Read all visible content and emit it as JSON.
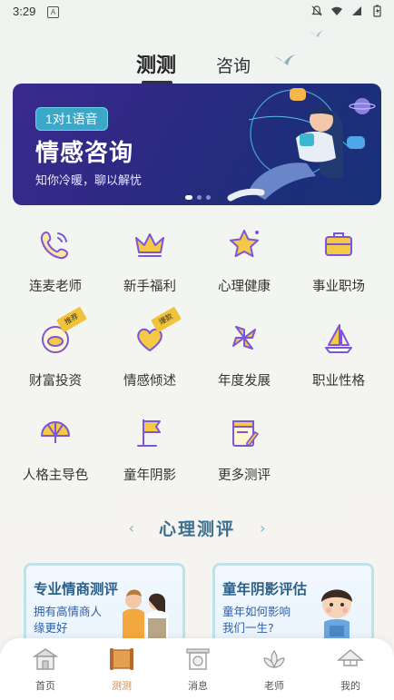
{
  "status_bar": {
    "time": "3:29",
    "app_icon": "A"
  },
  "top_tabs": [
    {
      "label": "测测",
      "active": true
    },
    {
      "label": "咨询",
      "active": false
    }
  ],
  "banner": {
    "tag": "1对1语音",
    "title": "情感咨询",
    "subtitle": "知你冷暖，聊以解忧",
    "slide_count": 3,
    "active_slide": 0
  },
  "grid": [
    {
      "label": "连麦老师",
      "icon": "phone-icon"
    },
    {
      "label": "新手福利",
      "icon": "crown-icon"
    },
    {
      "label": "心理健康",
      "icon": "star-icon"
    },
    {
      "label": "事业职场",
      "icon": "briefcase-icon"
    },
    {
      "label": "财富投资",
      "icon": "money-pot-icon",
      "badge": "推荐"
    },
    {
      "label": "情感倾述",
      "icon": "heart-icon",
      "badge": "爆款"
    },
    {
      "label": "年度发展",
      "icon": "pinwheel-icon"
    },
    {
      "label": "职业性格",
      "icon": "sailboat-icon"
    },
    {
      "label": "人格主导色",
      "icon": "fan-icon"
    },
    {
      "label": "童年阴影",
      "icon": "flag-icon"
    },
    {
      "label": "更多测评",
      "icon": "clipboard-icon"
    }
  ],
  "section": {
    "title": "心理测评"
  },
  "cards": [
    {
      "title": "专业情商测评",
      "subtitle": "拥有高情商人缘更好"
    },
    {
      "title": "童年阴影评估",
      "subtitle": "童年如何影响我们一生?"
    }
  ],
  "tabbar": [
    {
      "label": "首页",
      "icon": "home-icon",
      "active": false
    },
    {
      "label": "测测",
      "icon": "scroll-icon",
      "active": true
    },
    {
      "label": "消息",
      "icon": "gate-icon",
      "active": false
    },
    {
      "label": "老师",
      "icon": "lotus-icon",
      "active": false
    },
    {
      "label": "我的",
      "icon": "hat-icon",
      "active": false
    }
  ],
  "colors": {
    "accent": "#c8884a",
    "banner": "#2c2a82",
    "icon_purple": "#7c56d9",
    "icon_yellow": "#f3c946",
    "section_title": "#3a6f8e"
  }
}
